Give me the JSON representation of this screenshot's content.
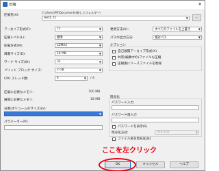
{
  "window": {
    "title": "圧縮",
    "close_glyph": "✕"
  },
  "archive": {
    "label": "圧縮先(A):",
    "path": "C:\\Users\\PR\\Documents\\新しいフォルダー\\",
    "filename": "test1.7z",
    "browse_label": "..."
  },
  "left_fields": [
    {
      "label": "アーカイブ形式(F):",
      "value": "7z"
    },
    {
      "label": "圧縮レベル(L):",
      "value": "標準"
    },
    {
      "label": "圧縮方式(M):",
      "value": "LZMA2"
    },
    {
      "label": "辞書サイズ(D):",
      "value": "16 MB"
    },
    {
      "label": "ワード サイズ(W):",
      "value": "32"
    },
    {
      "label": "ソリッド ブロック サイズ:",
      "value": "2 GB"
    },
    {
      "label": "CPU スレッド数:",
      "value": "4",
      "suffix": "/ 4"
    }
  ],
  "memory": [
    {
      "label": "圧縮に必要なメモリ:",
      "value": "700 MB"
    },
    {
      "label": "展開に必要なメモリ:",
      "value": "18 MB"
    }
  ],
  "split": {
    "label": "分割(ボリュームのサイズ)(V):",
    "value": ""
  },
  "params": {
    "label": "パラメーター(P):",
    "value": ""
  },
  "right_fields": [
    {
      "label": "更新方法(U):",
      "value": "すべてのファイルを上書き"
    },
    {
      "label": "パスの出力方法:",
      "value": "相対パス"
    }
  ],
  "options": {
    "title": "オプション",
    "items": [
      "自己展開アーカイブ形式(X)",
      "共有(編集中の)ファイルも圧縮",
      "圧縮後にソースファイルを削除"
    ]
  },
  "encryption": {
    "title": "暗号化",
    "pw_label": "パスワード入力",
    "pw_confirm_label": "パスワード再入力",
    "show_pw_label": "パスワードを表示(S)",
    "method_label": "暗号化方式:",
    "method_value": "AES-256",
    "encrypt_names_label": "ファイル名を暗号化(N)"
  },
  "annotation": "ここを左クリック",
  "buttons": {
    "ok": "OK",
    "cancel": "キャンセル",
    "help": "ヘルプ"
  },
  "colors": {
    "annotation": "#e60012",
    "selection": "#3a78d7",
    "ok_border": "#0078d7"
  }
}
